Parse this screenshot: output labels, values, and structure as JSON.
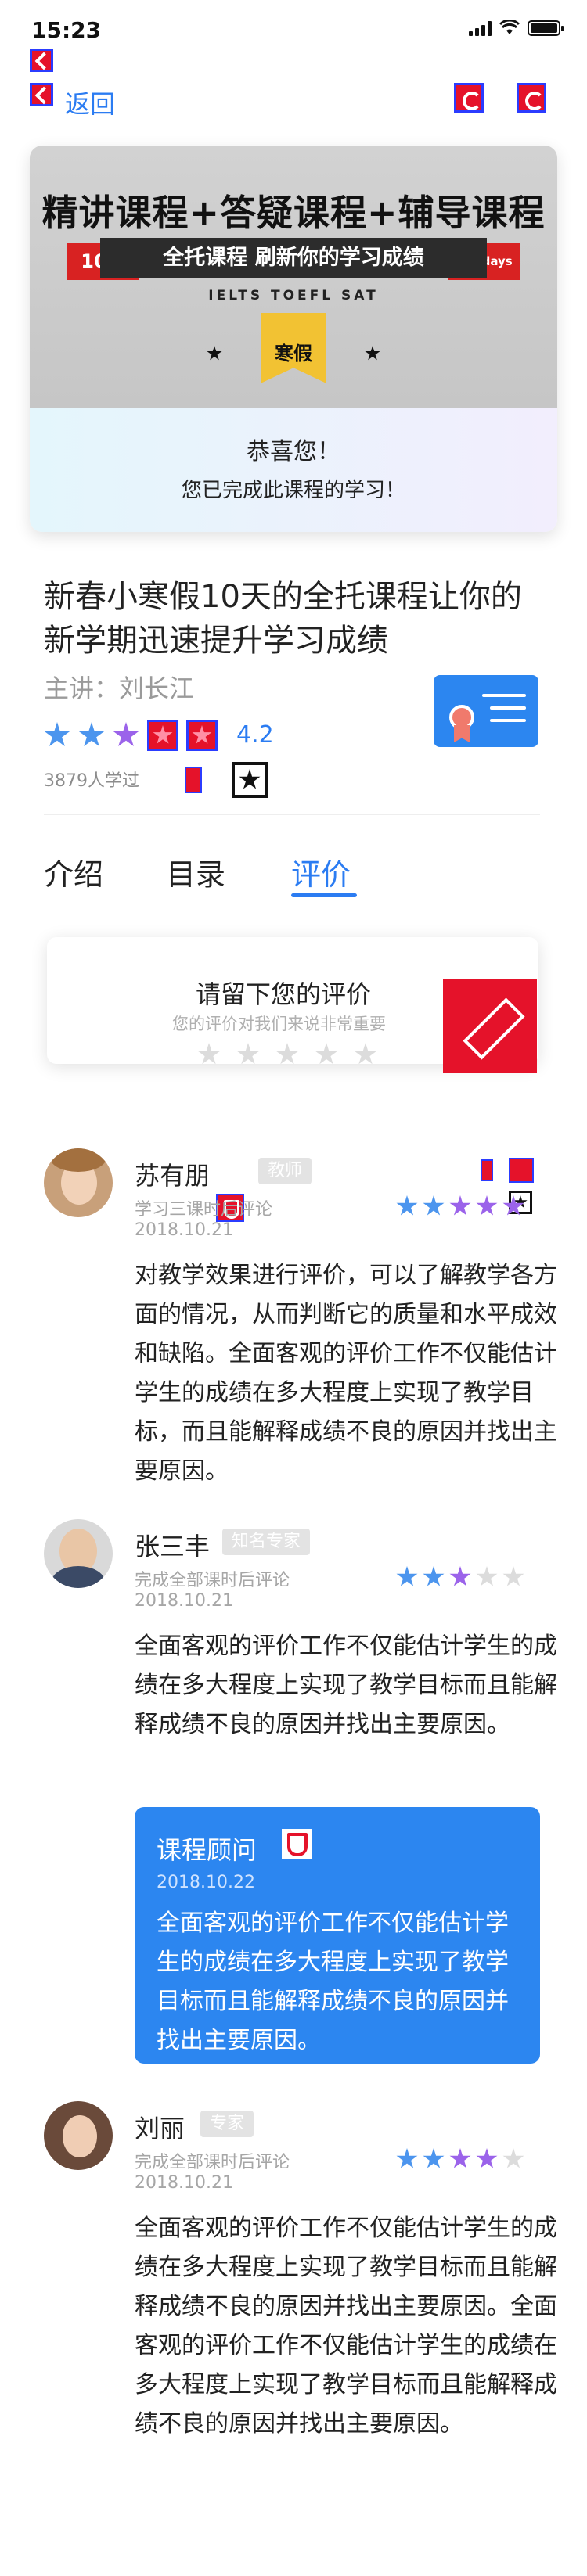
{
  "status_bar": {
    "time": "15:23"
  },
  "nav": {
    "back_label": "返回"
  },
  "banner": {
    "headline": "精讲课程+答疑课程+辅导课程",
    "ribbon_text": "全托课程 刷新你的学习成绩",
    "ribbon_left": "10天",
    "ribbon_right": "Ten days",
    "exams": "IELTS TOEFL SAT",
    "badge_text": "寒假",
    "congrats_title": "恭喜您！",
    "congrats_message": "您已完成此课程的学习！"
  },
  "course": {
    "title": "新春小寒假10天的全托课程让你的新学期迅速提升学习成绩",
    "lecturer": "主讲：刘长江",
    "rating": "4.2",
    "learners": "3879人学过"
  },
  "tabs": [
    {
      "label": "介绍",
      "active": false
    },
    {
      "label": "目录",
      "active": false
    },
    {
      "label": "评价",
      "active": true
    }
  ],
  "review_prompt": {
    "title": "请留下您的评价",
    "subtitle": "您的评价对我们来说非常重要"
  },
  "reviews": [
    {
      "name": "苏有朋",
      "tag": "教师",
      "context": "学习三课时后评论",
      "date": "2018.10.21",
      "stars": 5,
      "text": "对教学效果进行评价，可以了解教学各方面的情况，从而判断它的质量和水平成效和缺陷。全面客观的评价工作不仅能估计学生的成绩在多大程度上实现了教学目标，而且能解释成绩不良的原因并找出主要原因。"
    },
    {
      "name": "张三丰",
      "tag": "知名专家",
      "context": "完成全部课时后评论",
      "date": "2018.10.21",
      "stars": 3,
      "text": "全面客观的评价工作不仅能估计学生的成绩在多大程度上实现了教学目标而且能解释成绩不良的原因并找出主要原因。",
      "reply": {
        "title": "课程顾问",
        "date": "2018.10.22",
        "text": "全面客观的评价工作不仅能估计学生的成绩在多大程度上实现了教学目标而且能解释成绩不良的原因并找出主要原因。"
      }
    },
    {
      "name": "刘丽",
      "tag": "专家",
      "context": "完成全部课时后评论",
      "date": "2018.10.21",
      "stars": 4,
      "text": "全面客观的评价工作不仅能估计学生的成绩在多大程度上实现了教学目标而且能解释成绩不良的原因并找出主要原因。全面客观的评价工作不仅能估计学生的成绩在多大程度上实现了教学目标而且能解释成绩不良的原因并找出主要原因。"
    }
  ],
  "colors": {
    "accent": "#2b7cf2",
    "star_blue": "#4c95ee",
    "star_purple": "#9b63ea",
    "icon_red": "#e5122a"
  }
}
